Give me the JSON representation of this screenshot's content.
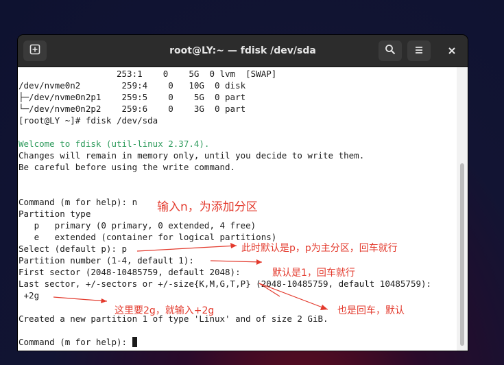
{
  "window": {
    "title": "root@LY:~ — fdisk /dev/sda"
  },
  "icons": {
    "new_tab": "add-tab-icon",
    "search": "search-icon",
    "menu": "hamburger-menu-icon",
    "close": "close-icon"
  },
  "terminal": {
    "lines": [
      "                   253:1    0    5G  0 lvm  [SWAP]",
      "/dev/nvme0n2        259:4    0   10G  0 disk",
      "├─/dev/nvme0n2p1    259:5    0    5G  0 part",
      "└─/dev/nvme0n2p2    259:6    0    3G  0 part",
      "[root@LY ~]# fdisk /dev/sda",
      "",
      "Welcome to fdisk (util-linux 2.37.4).",
      "Changes will remain in memory only, until you decide to write them.",
      "Be careful before using the write command.",
      "",
      "",
      "Command (m for help): n",
      "Partition type",
      "   p   primary (0 primary, 0 extended, 4 free)",
      "   e   extended (container for logical partitions)",
      "Select (default p): p",
      "Partition number (1-4, default 1):",
      "First sector (2048-10485759, default 2048):",
      "Last sector, +/-sectors or +/-size{K,M,G,T,P} (2048-10485759, default 10485759):",
      " +2g",
      "",
      "Created a new partition 1 of type 'Linux' and of size 2 GiB.",
      "",
      "Command (m for help): "
    ]
  },
  "annotations": {
    "a1": "输入n，为添加分区",
    "a2": "此时默认是p，p为主分区，回车就行",
    "a3": "默认是1，回车就行",
    "a4": "这里要2g，就输入+2g",
    "a5": "也是回车，默认"
  },
  "colors": {
    "annotation": "#e33a2d",
    "welcome_text": "#2e9b5c",
    "titlebar": "#2c2c2c",
    "terminal_bg": "#ffffff"
  }
}
